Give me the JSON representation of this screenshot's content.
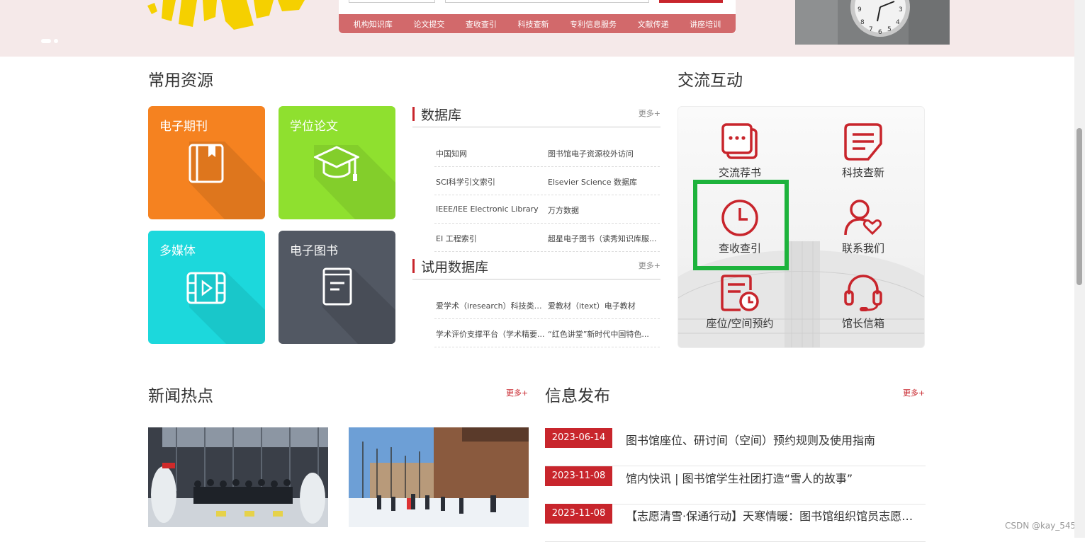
{
  "quicknav": [
    "机构知识库",
    "论文提交",
    "查收查引",
    "科技查新",
    "专利信息服务",
    "文献传递",
    "讲座培训"
  ],
  "common": {
    "title": "常用资源",
    "tiles": [
      {
        "label": "电子期刊",
        "color": "#f58220",
        "icon": "book-icon"
      },
      {
        "label": "学位论文",
        "color": "#8fe02f",
        "icon": "graduation-cap-icon"
      },
      {
        "label": "多媒体",
        "color": "#1cd8dc",
        "icon": "video-icon"
      },
      {
        "label": "电子图书",
        "color": "#525863",
        "icon": "ebook-icon"
      }
    ]
  },
  "database": {
    "title": "数据库",
    "more": "更多+",
    "rows": [
      [
        "中国知网",
        "图书馆电子资源校外访问"
      ],
      [
        "SCI科学引文索引",
        "Elsevier Science 数据库"
      ],
      [
        "IEEE/IEE Electronic Library",
        "万方数据"
      ],
      [
        "EI 工程索引",
        "超星电子图书（读秀知识库服..."
      ]
    ]
  },
  "trial": {
    "title": "试用数据库",
    "more": "更多+",
    "rows": [
      [
        "爱学术（iresearch）科技类外...",
        "爱教材（itext）电子教材"
      ],
      [
        "学术评价支撑平台（学术精要...",
        "“红色讲堂”新时代中国特色..."
      ]
    ]
  },
  "interaction": {
    "title": "交流互动",
    "items": [
      {
        "label": "交流荐书",
        "icon": "chat-icon"
      },
      {
        "label": "科技查新",
        "icon": "document-list-icon"
      },
      {
        "label": "查收查引",
        "icon": "clock-icon"
      },
      {
        "label": "联系我们",
        "icon": "user-heart-icon"
      },
      {
        "label": "座位/空间预约",
        "icon": "reservation-icon"
      },
      {
        "label": "馆长信箱",
        "icon": "headset-icon"
      }
    ],
    "accent": "#c8252c",
    "highlight": "#1db33c"
  },
  "news": {
    "title": "新闻热点",
    "more": "更多+"
  },
  "info": {
    "title": "信息发布",
    "more": "更多+",
    "items": [
      {
        "date": "2023-06-14",
        "text": "图书馆座位、研讨间（空间）预约规则及使用指南"
      },
      {
        "date": "2023-11-08",
        "text": "馆内快讯 | 图书馆学生社团打造“雪人的故事”"
      },
      {
        "date": "2023-11-08",
        "text": "【志愿清雪·保通行动】天寒情暖：图书馆组织馆员志愿者..."
      }
    ]
  },
  "watermark": "CSDN @kay_545"
}
